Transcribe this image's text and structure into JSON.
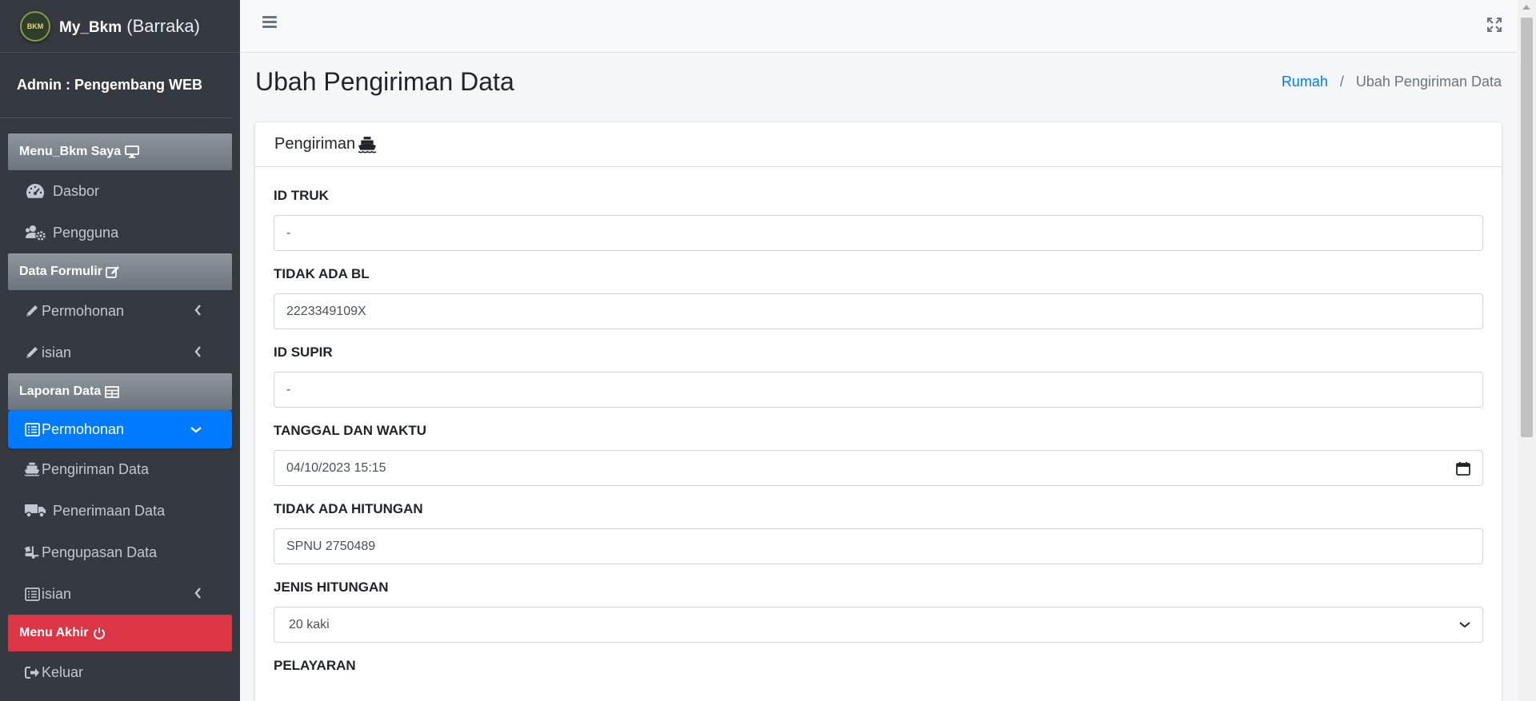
{
  "sidebar": {
    "brand_bold": "My_Bkm",
    "brand_light": "(Barraka)",
    "logo_text": "BKM",
    "user": "Admin : Pengembang WEB",
    "headers": {
      "menu": "Menu_Bkm Saya",
      "form": "Data Formulir",
      "report": "Laporan Data",
      "end": "Menu Akhir"
    },
    "items": {
      "dashboard": "Dasbor",
      "users": "Pengguna",
      "permohonan1": "Permohonan",
      "isian1": "isian",
      "permohonan2": "Permohonan",
      "pengiriman": "Pengiriman Data",
      "penerimaan": "Penerimaan Data",
      "pengupasan": "Pengupasan Data",
      "isian2": "isian",
      "logout": "Keluar"
    }
  },
  "header": {
    "title": "Ubah Pengiriman Data",
    "breadcrumb_home": "Rumah",
    "breadcrumb_current": "Ubah Pengiriman Data"
  },
  "card": {
    "title": "Pengiriman"
  },
  "form": {
    "truck_label": "ID TRUK",
    "truck_value": "-",
    "bl_label": "TIDAK ADA BL",
    "bl_value": "2223349109X",
    "driver_label": "ID SUPIR",
    "driver_value": "-",
    "datetime_label": "TANGGAL DAN WAKTU",
    "datetime_value": "04/10/2023 15:15",
    "count_label": "TIDAK ADA HITUNGAN",
    "count_value": "SPNU 2750489",
    "type_label": "JENIS HITUNGAN",
    "type_value": "20 kaki",
    "shipping_label": "PELAYARAN"
  },
  "colors": {
    "sidebar_bg": "#343a40",
    "active": "#007bff",
    "danger": "#dc3545",
    "link": "#007bff"
  }
}
